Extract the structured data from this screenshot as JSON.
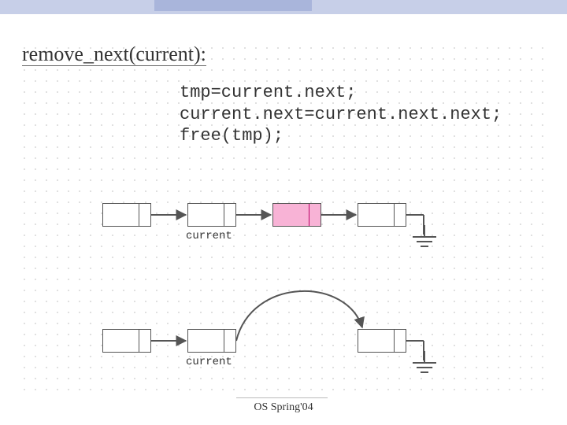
{
  "title": "remove_next(current):",
  "code_lines": [
    "tmp=current.next;",
    "current.next=current.next.next;",
    "free(tmp);"
  ],
  "diagram1": {
    "label": "current"
  },
  "diagram2": {
    "label": "current"
  },
  "footer": "OS Spring'04"
}
